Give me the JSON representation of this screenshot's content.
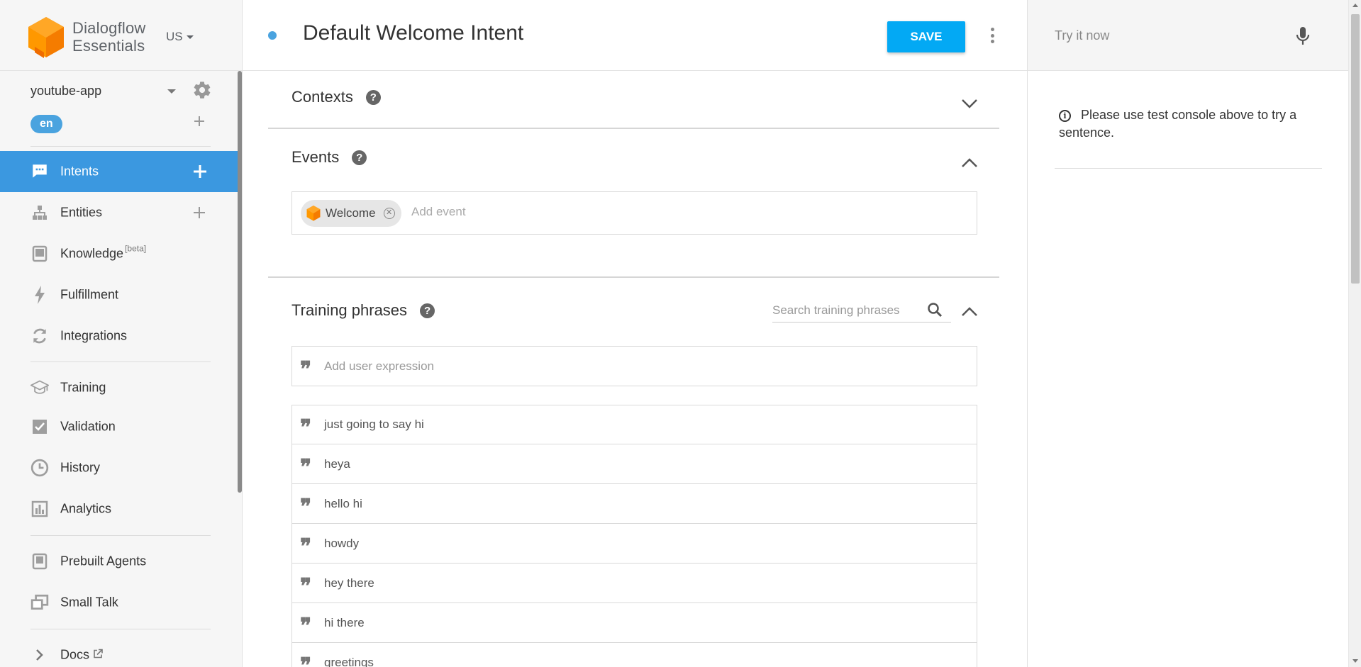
{
  "brand": {
    "line1": "Dialogflow",
    "line2": "Essentials",
    "region": "US"
  },
  "agent": {
    "name": "youtube-app",
    "language": "en"
  },
  "nav": {
    "items": [
      {
        "label": "Intents",
        "icon": "chat-bubble-icon",
        "active": true
      },
      {
        "label": "Entities",
        "icon": "hierarchy-icon"
      },
      {
        "label": "Knowledge",
        "beta": "[beta]",
        "icon": "book-icon"
      },
      {
        "label": "Fulfillment",
        "icon": "lightning-icon"
      },
      {
        "label": "Integrations",
        "icon": "sync-icon"
      },
      {
        "label": "Training",
        "icon": "graduation-cap-icon"
      },
      {
        "label": "Validation",
        "icon": "check-box-icon"
      },
      {
        "label": "History",
        "icon": "clock-icon"
      },
      {
        "label": "Analytics",
        "icon": "bar-chart-icon"
      },
      {
        "label": "Prebuilt Agents",
        "icon": "agent-book-icon"
      },
      {
        "label": "Small Talk",
        "icon": "chat-squares-icon"
      },
      {
        "label": "Docs",
        "icon": "chevron-right-icon"
      }
    ]
  },
  "header": {
    "title": "Default Welcome Intent",
    "save_label": "SAVE"
  },
  "sections": {
    "contexts": {
      "title": "Contexts",
      "help": "?"
    },
    "events": {
      "title": "Events",
      "help": "?",
      "chip": "Welcome",
      "placeholder": "Add event"
    },
    "training": {
      "title": "Training phrases",
      "help": "?",
      "search_placeholder": "Search training phrases",
      "add_placeholder": "Add user expression",
      "phrases": [
        "just going to say hi",
        "heya",
        "hello hi",
        "howdy",
        "hey there",
        "hi there",
        "greetings"
      ]
    }
  },
  "test_console": {
    "placeholder": "Try it now",
    "info": "Please use test console above to try a sentence."
  },
  "colors": {
    "accent": "#03a9f4",
    "active_nav": "#3b98e0",
    "logo_orange": "#f57c00"
  }
}
